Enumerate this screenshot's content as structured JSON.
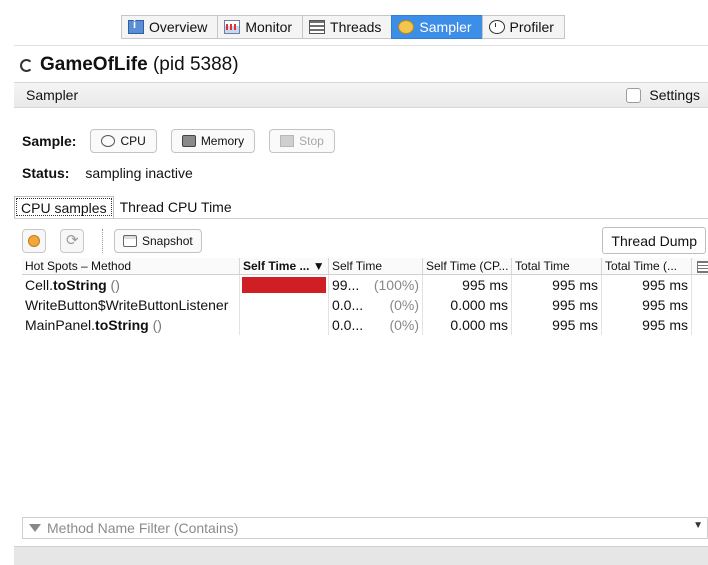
{
  "top_tabs": [
    {
      "label": "Overview",
      "icon": "overview-icon"
    },
    {
      "label": "Monitor",
      "icon": "monitor-icon"
    },
    {
      "label": "Threads",
      "icon": "threads-icon"
    },
    {
      "label": "Sampler",
      "icon": "sampler-icon",
      "active": true
    },
    {
      "label": "Profiler",
      "icon": "profiler-icon"
    }
  ],
  "title": {
    "app": "GameOfLife",
    "pid": "(pid 5388)"
  },
  "sampler_bar": {
    "label": "Sampler",
    "settings_label": "Settings"
  },
  "sample": {
    "label": "Sample:",
    "cpu_label": "CPU",
    "memory_label": "Memory",
    "stop_label": "Stop"
  },
  "status": {
    "label": "Status:",
    "value": "sampling inactive"
  },
  "sub_tabs": [
    {
      "label": "CPU samples",
      "active": true
    },
    {
      "label": "Thread CPU Time"
    }
  ],
  "toolbar": {
    "snapshot_label": "Snapshot",
    "thread_dump_label": "Thread Dump"
  },
  "table": {
    "columns": [
      "Hot Spots – Method",
      "Self Time ... ▼",
      "Self Time",
      "Self Time (CP...",
      "Total Time",
      "Total Time (..."
    ],
    "rows": [
      {
        "class": "Cell.",
        "method": "toString",
        "sig": " ()",
        "bar_fraction": 1.0,
        "self_time": "99...",
        "self_pct": "(100%)",
        "self_cpu": "995 ms",
        "total": "995 ms",
        "total_cpu": "995 ms"
      },
      {
        "class": "WriteButton$WriteButtonListener",
        "method": "",
        "sig": "",
        "bar_fraction": 0.0,
        "self_time": "0.0...",
        "self_pct": "(0%)",
        "self_cpu": "0.000 ms",
        "total": "995 ms",
        "total_cpu": "995 ms"
      },
      {
        "class": "MainPanel.",
        "method": "toString",
        "sig": " ()",
        "bar_fraction": 0.0,
        "self_time": "0.0...",
        "self_pct": "(0%)",
        "self_cpu": "0.000 ms",
        "total": "995 ms",
        "total_cpu": "995 ms"
      }
    ]
  },
  "filter": {
    "placeholder": "Method Name Filter (Contains)"
  },
  "colors": {
    "active_tab": "#3d8ee6",
    "bar": "#cf1f25"
  }
}
